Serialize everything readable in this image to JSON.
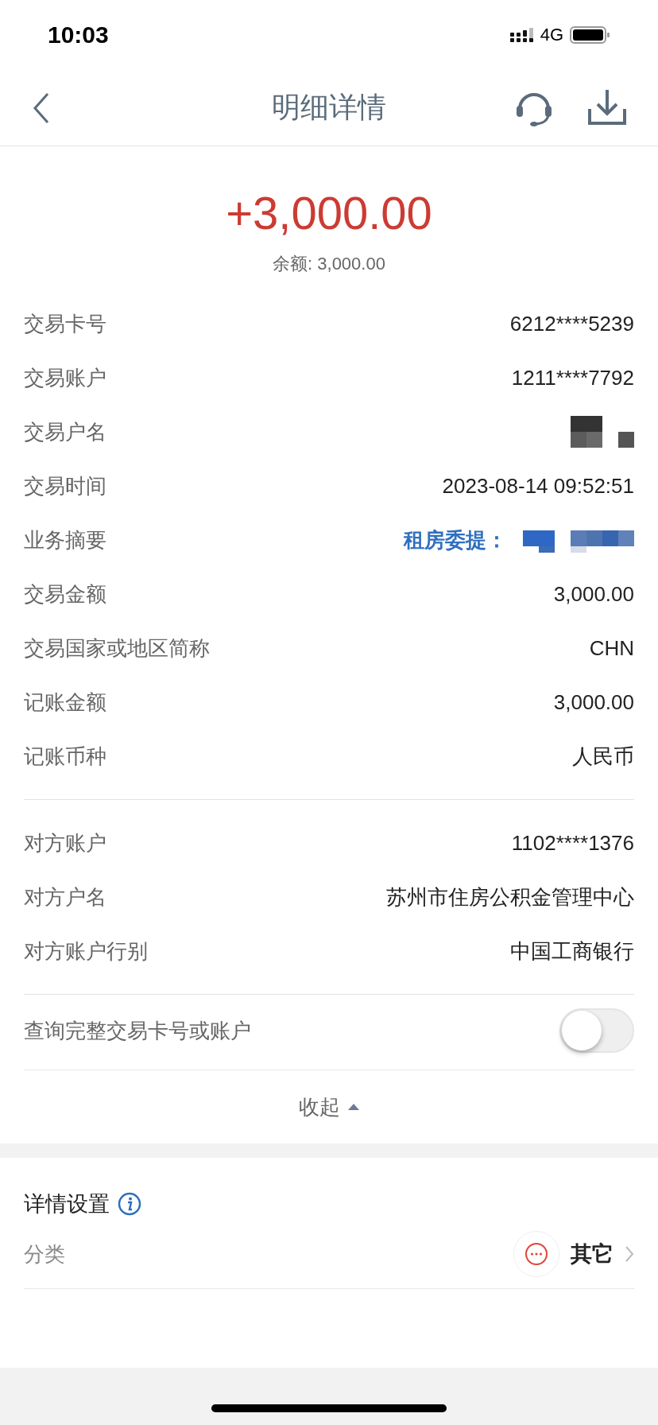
{
  "status_bar": {
    "time": "10:03",
    "network": "4G"
  },
  "nav": {
    "title": "明细详情"
  },
  "amount": {
    "value": "+3,000.00",
    "balance": "余额: 3,000.00"
  },
  "details": [
    {
      "label": "交易卡号",
      "value": "6212****5239",
      "kind": "text"
    },
    {
      "label": "交易账户",
      "value": "1211****7792",
      "kind": "text"
    },
    {
      "label": "交易户名",
      "kind": "redacted"
    },
    {
      "label": "交易时间",
      "value": "2023-08-14 09:52:51",
      "kind": "text"
    },
    {
      "label": "业务摘要",
      "value": "租房委提：",
      "kind": "summary"
    },
    {
      "label": "交易金额",
      "value": "3,000.00",
      "kind": "text"
    },
    {
      "label": "交易国家或地区简称",
      "value": "CHN",
      "kind": "text"
    },
    {
      "label": "记账金额",
      "value": "3,000.00",
      "kind": "text"
    },
    {
      "label": "记账币种",
      "value": "人民币",
      "kind": "text"
    }
  ],
  "counterparty": [
    {
      "label": "对方账户",
      "value": "1102****1376",
      "kind": "text"
    },
    {
      "label": "对方户名",
      "value": "苏州市住房公积金管理中心",
      "kind": "text"
    },
    {
      "label": "对方账户行别",
      "value": "中国工商银行",
      "kind": "text"
    }
  ],
  "full_number_toggle": {
    "label": "查询完整交易卡号或账户",
    "on": false
  },
  "collapse": {
    "label": "收起"
  },
  "settings": {
    "title": "详情设置",
    "category": {
      "label": "分类",
      "value": "其它"
    }
  }
}
